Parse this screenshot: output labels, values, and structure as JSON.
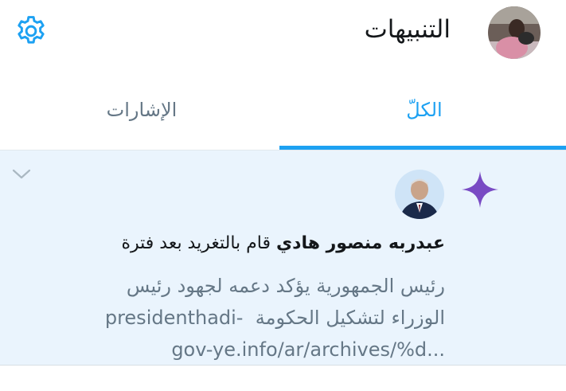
{
  "header": {
    "title": "التنبيهات",
    "settings_icon": "gear-icon",
    "avatar_icon": "user-avatar"
  },
  "tabs": [
    {
      "label": "الكلّ",
      "active": true
    },
    {
      "label": "الإشارات",
      "active": false
    }
  ],
  "notification": {
    "icon": "sparkle-icon",
    "actor_name": "عبدربه منصور هادي",
    "action_text": "قام بالتغريد بعد فترة",
    "preview_line1": "رئيس الجمهورية يؤكد دعمه لجهود رئيس",
    "preview_line2_ar": "الوزراء لتشكيل الحكومة",
    "preview_line2_url": "presidenthadi-",
    "preview_line3": "gov-ye.info/ar/archives/%d..."
  },
  "colors": {
    "accent": "#1da1f2",
    "sparkle": "#794bc4",
    "highlight_bg": "#eaf4fd"
  }
}
